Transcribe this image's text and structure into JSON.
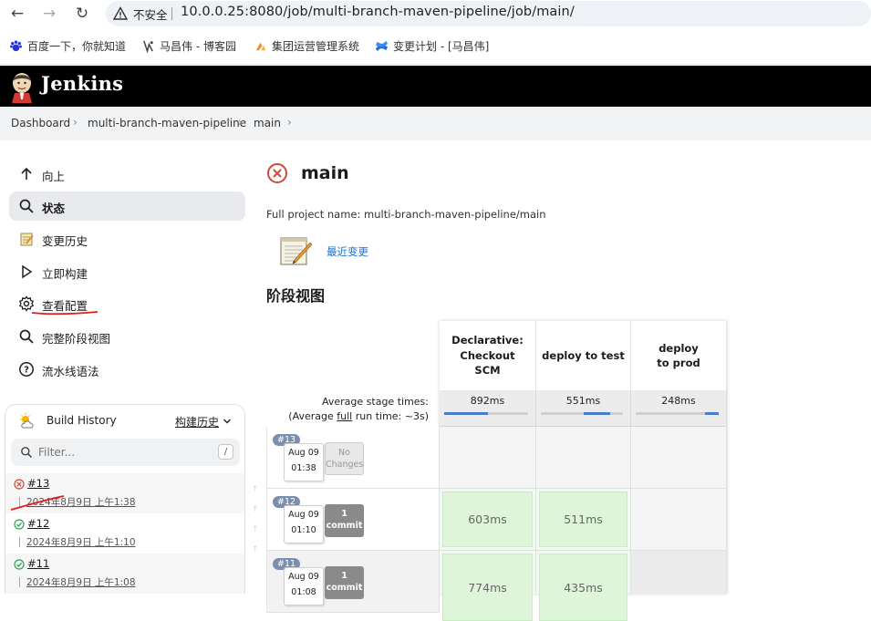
{
  "browser": {
    "insecure_label": "不安全",
    "url": "10.0.0.25:8080/job/multi-branch-maven-pipeline/job/main/",
    "bookmarks": [
      {
        "label": "百度一下，你就知道",
        "icon": "baidu-icon"
      },
      {
        "label": "马昌伟 - 博客园",
        "icon": "cnblogs-icon"
      },
      {
        "label": "集团运营管理系统",
        "icon": "system-icon"
      },
      {
        "label": "变更计划 - [马昌伟]",
        "icon": "confluence-icon"
      }
    ]
  },
  "jenkins": {
    "brand": "Jenkins",
    "breadcrumb": [
      "Dashboard",
      "multi-branch-maven-pipeline",
      "main"
    ]
  },
  "sidebar": {
    "items": [
      {
        "label": "向上",
        "icon": "arrow-up-icon"
      },
      {
        "label": "状态",
        "icon": "search-icon",
        "active": true
      },
      {
        "label": "变更历史",
        "icon": "notepad-icon"
      },
      {
        "label": "立即构建",
        "icon": "play-icon"
      },
      {
        "label": "查看配置",
        "icon": "gear-icon"
      },
      {
        "label": "完整阶段视图",
        "icon": "search-icon"
      },
      {
        "label": "流水线语法",
        "icon": "help-icon"
      }
    ]
  },
  "build_history": {
    "title": "Build History",
    "link": "构建历史",
    "filter_placeholder": "Filter...",
    "filter_key": "/",
    "builds": [
      {
        "number": "#13",
        "date": "2024年8月9日 上午1:38",
        "status": "failed"
      },
      {
        "number": "#12",
        "date": "2024年8月9日 上午1:10",
        "status": "success"
      },
      {
        "number": "#11",
        "date": "2024年8月9日 上午1:08",
        "status": "success"
      }
    ]
  },
  "main": {
    "title": "main",
    "full_name": "Full project name: multi-branch-maven-pipeline/main",
    "recent_changes": "最近变更",
    "stage_view_title": "阶段视图"
  },
  "stage_view": {
    "avg_label_1": "Average stage times:",
    "avg_label_2a": "(Average ",
    "avg_label_2b": "full",
    "avg_label_2c": " run time: ~3s)",
    "stages": [
      {
        "name": "Declarative: Checkout SCM",
        "avg": "892ms",
        "fill": [
          0.0,
          0.52
        ]
      },
      {
        "name": "deploy to test",
        "avg": "551ms",
        "fill": [
          0.52,
          0.84
        ]
      },
      {
        "name": "deploy to prod",
        "avg": "248ms",
        "fill": [
          0.84,
          1.0
        ]
      }
    ],
    "runs": [
      {
        "badge": "#13",
        "date": "Aug 09",
        "time": "01:38",
        "changes_line1": "No",
        "changes_line2": "Changes",
        "changes_type": "none",
        "cells": [
          "",
          "",
          ""
        ]
      },
      {
        "badge": "#12",
        "date": "Aug 09",
        "time": "01:10",
        "changes_line1": "1",
        "changes_line2": "commit",
        "changes_type": "commit",
        "cells": [
          "603ms",
          "511ms",
          ""
        ]
      },
      {
        "badge": "#11",
        "date": "Aug 09",
        "time": "01:08",
        "changes_line1": "1",
        "changes_line2": "commit",
        "changes_type": "commit",
        "cells": [
          "774ms",
          "435ms",
          ""
        ]
      }
    ]
  },
  "colors": {
    "jenkins_header": "#000000",
    "failed": "#d24939",
    "success": "#2aa44f",
    "link": "#1e6fcc",
    "stage_ok": "#dff5d9",
    "avg_bar": "#4a7ec9",
    "annotation": "#e21b1b"
  }
}
